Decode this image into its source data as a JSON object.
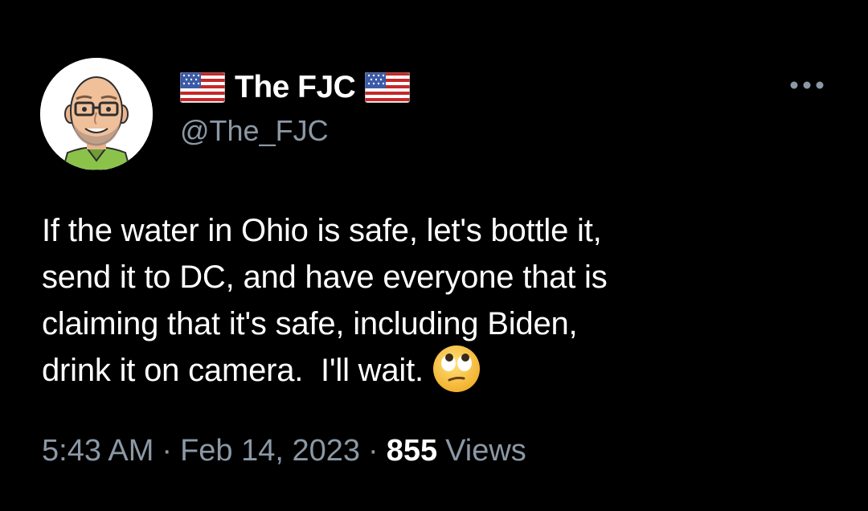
{
  "author": {
    "display_name": "The FJC",
    "handle": "@The_FJC",
    "name_flag_icon": "us-flag-emoji",
    "avatar_icon": "bald-man-with-glasses-avatar"
  },
  "tweet": {
    "lines": [
      "If the water in Ohio is safe, let's bottle it,",
      "send it to DC, and have everyone that is",
      "claiming that it's safe, including Biden,",
      "drink it on camera.  I'll wait."
    ],
    "trailing_emoji": "face-with-rolling-eyes-emoji"
  },
  "meta": {
    "time": "5:43 AM",
    "separator": "·",
    "date": "Feb 14, 2023",
    "views_count": "855",
    "views_label": "Views"
  },
  "menu": {
    "more_icon": "more-options-icon"
  },
  "colors": {
    "background": "#000000",
    "primary_text": "#ffffff",
    "secondary_text": "#8b98a5"
  }
}
